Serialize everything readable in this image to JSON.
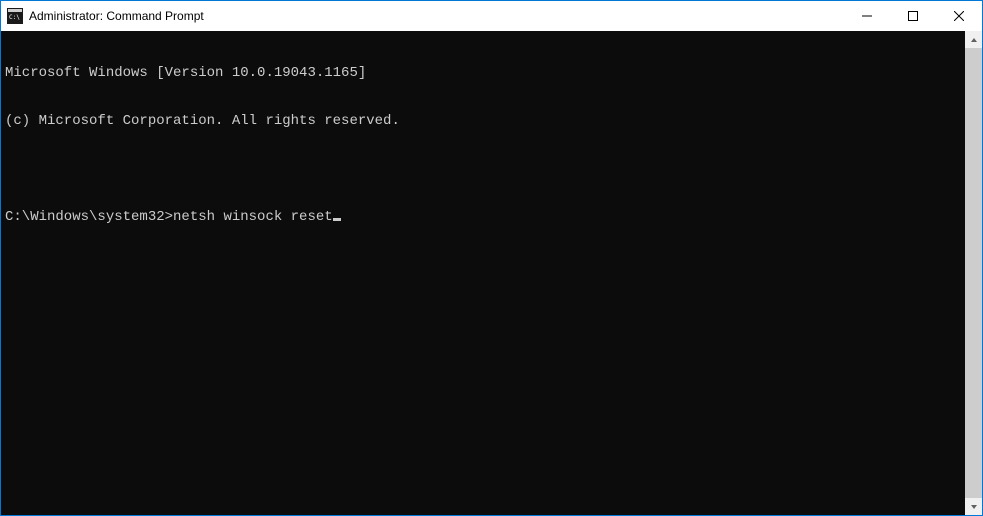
{
  "window": {
    "title": "Administrator: Command Prompt"
  },
  "terminal": {
    "header_line1": "Microsoft Windows [Version 10.0.19043.1165]",
    "header_line2": "(c) Microsoft Corporation. All rights reserved.",
    "prompt": "C:\\Windows\\system32>",
    "command": "netsh winsock reset"
  }
}
